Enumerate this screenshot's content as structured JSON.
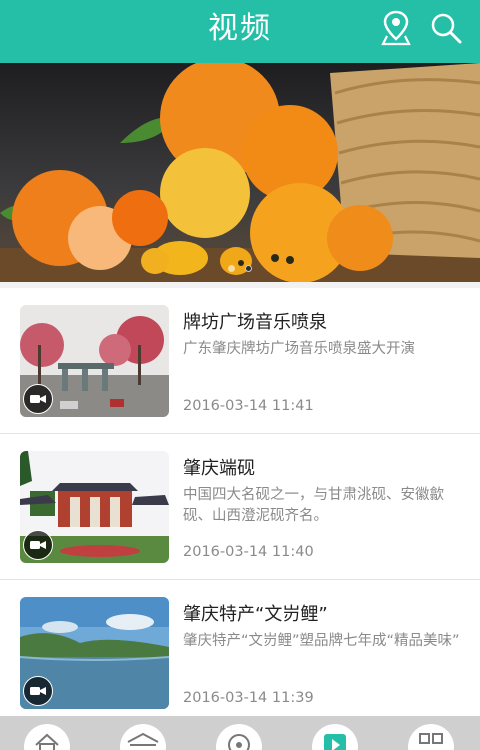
{
  "header": {
    "title": "视频",
    "location_icon": "location-pin-icon",
    "search_icon": "search-icon",
    "color": "#25bfa8"
  },
  "banner": {
    "image": "oranges-basket-photo",
    "dots_count": 2,
    "active_dot": 1
  },
  "videos": [
    {
      "title": "牌坊广场音乐喷泉",
      "description": "广东肇庆牌坊广场音乐喷泉盛大开演",
      "date": "2016-03-14 11:41",
      "thumb": "memorial-archway-plaza-photo"
    },
    {
      "title": "肇庆端砚",
      "description": "中国四大名砚之一，与甘肃洮砚、安徽歙砚、山西澄泥砚齐名。",
      "date": "2016-03-14 11:40",
      "thumb": "duanyan-museum-building-photo"
    },
    {
      "title": "肇庆特产“文岃鲤”",
      "description": "肇庆特产“文岃鲤”塑品牌七年成“精品美味”",
      "date": "2016-03-14 11:39",
      "thumb": "lake-landscape-photo"
    }
  ],
  "tabbar": {
    "tabs": [
      "home-icon",
      "building-icon",
      "compass-icon",
      "video-play-icon",
      "grid-icon"
    ],
    "active_index": 3,
    "active_color": "#25bfa8"
  }
}
